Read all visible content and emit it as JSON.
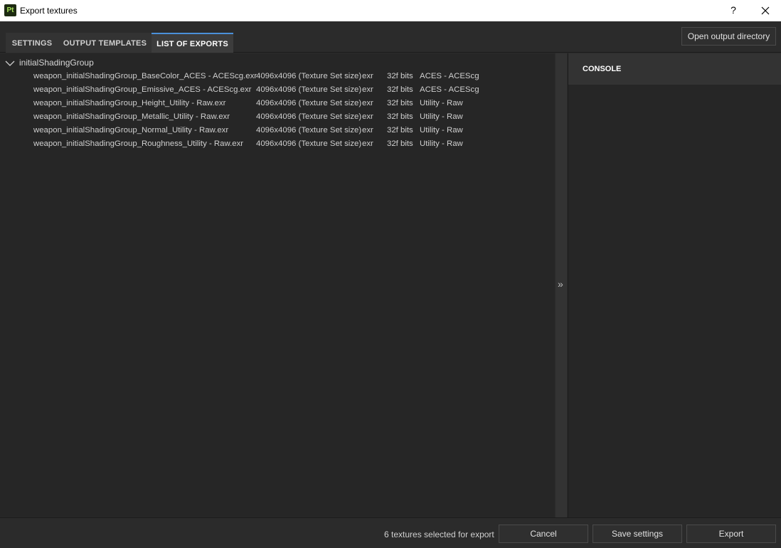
{
  "window": {
    "title": "Export textures",
    "app_icon_text": "Pt",
    "help_label": "?"
  },
  "tabs": [
    {
      "label": "SETTINGS",
      "active": false
    },
    {
      "label": "OUTPUT TEMPLATES",
      "active": false
    },
    {
      "label": "LIST OF EXPORTS",
      "active": true
    }
  ],
  "toolbar": {
    "open_output_directory_label": "Open output directory"
  },
  "exports": {
    "group_name": "initialShadingGroup",
    "rows": [
      {
        "name": "weapon_initialShadingGroup_BaseColor_ACES - ACEScg.exr",
        "size": "4096x4096 (Texture Set size)",
        "format": "exr",
        "bits": "32f bits",
        "colorspace": "ACES - ACEScg"
      },
      {
        "name": "weapon_initialShadingGroup_Emissive_ACES - ACEScg.exr",
        "size": "4096x4096 (Texture Set size)",
        "format": "exr",
        "bits": "32f bits",
        "colorspace": "ACES - ACEScg"
      },
      {
        "name": "weapon_initialShadingGroup_Height_Utility - Raw.exr",
        "size": "4096x4096 (Texture Set size)",
        "format": "exr",
        "bits": "32f bits",
        "colorspace": "Utility - Raw"
      },
      {
        "name": "weapon_initialShadingGroup_Metallic_Utility - Raw.exr",
        "size": "4096x4096 (Texture Set size)",
        "format": "exr",
        "bits": "32f bits",
        "colorspace": "Utility - Raw"
      },
      {
        "name": "weapon_initialShadingGroup_Normal_Utility - Raw.exr",
        "size": "4096x4096 (Texture Set size)",
        "format": "exr",
        "bits": "32f bits",
        "colorspace": "Utility - Raw"
      },
      {
        "name": "weapon_initialShadingGroup_Roughness_Utility - Raw.exr",
        "size": "4096x4096 (Texture Set size)",
        "format": "exr",
        "bits": "32f bits",
        "colorspace": "Utility - Raw"
      }
    ]
  },
  "splitter": {
    "arrow": "»"
  },
  "console": {
    "title": "CONSOLE"
  },
  "footer": {
    "status": "6 textures selected for export",
    "cancel_label": "Cancel",
    "save_settings_label": "Save settings",
    "export_label": "Export"
  },
  "colors": {
    "accent": "#4a90d9",
    "background": "#262626",
    "panel": "#2b2b2b"
  }
}
